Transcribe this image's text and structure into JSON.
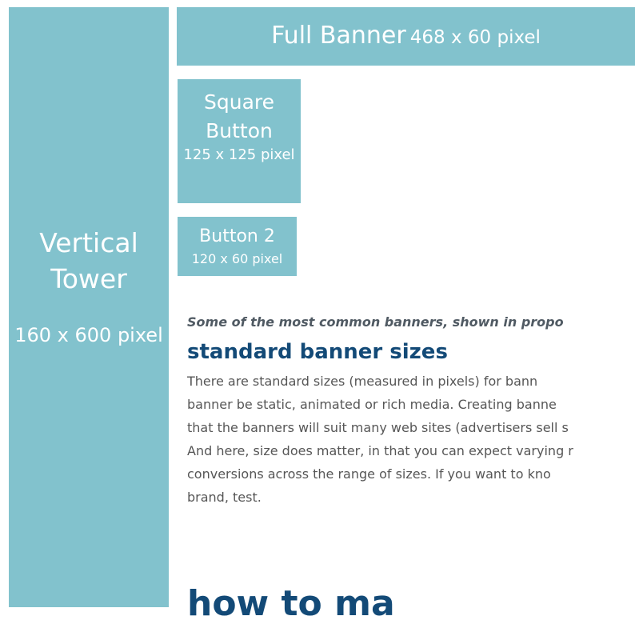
{
  "banners": {
    "tower": {
      "name_line1": "Vertical",
      "name_line2": "Tower",
      "size": "160 x 600 pixel"
    },
    "full": {
      "name": "Full Banner",
      "size": "468 x 60 pixel"
    },
    "square": {
      "name_line1": "Square",
      "name_line2": "Button",
      "size": "125 x 125 pixel"
    },
    "button2": {
      "name": "Button 2",
      "size": "120 x 60 pixel"
    }
  },
  "content": {
    "caption": "Some of the most common banners, shown in propo",
    "heading": "standard banner sizes",
    "paragraph_lines": [
      "There are standard sizes (measured in pixels) for bann",
      "banner be static, animated or rich media. Creating banne",
      "that the banners will suit many web sites (advertisers sell s",
      "And here, size does matter, in that you can expect varying r",
      "conversions across the range of sizes. If you want to kno",
      "brand, test."
    ],
    "heading2": "how to ma"
  },
  "colors": {
    "banner_fill": "#82c2cd",
    "banner_text": "#ffffff",
    "heading": "#134a77",
    "caption": "#505a63",
    "body_text": "#565656"
  }
}
